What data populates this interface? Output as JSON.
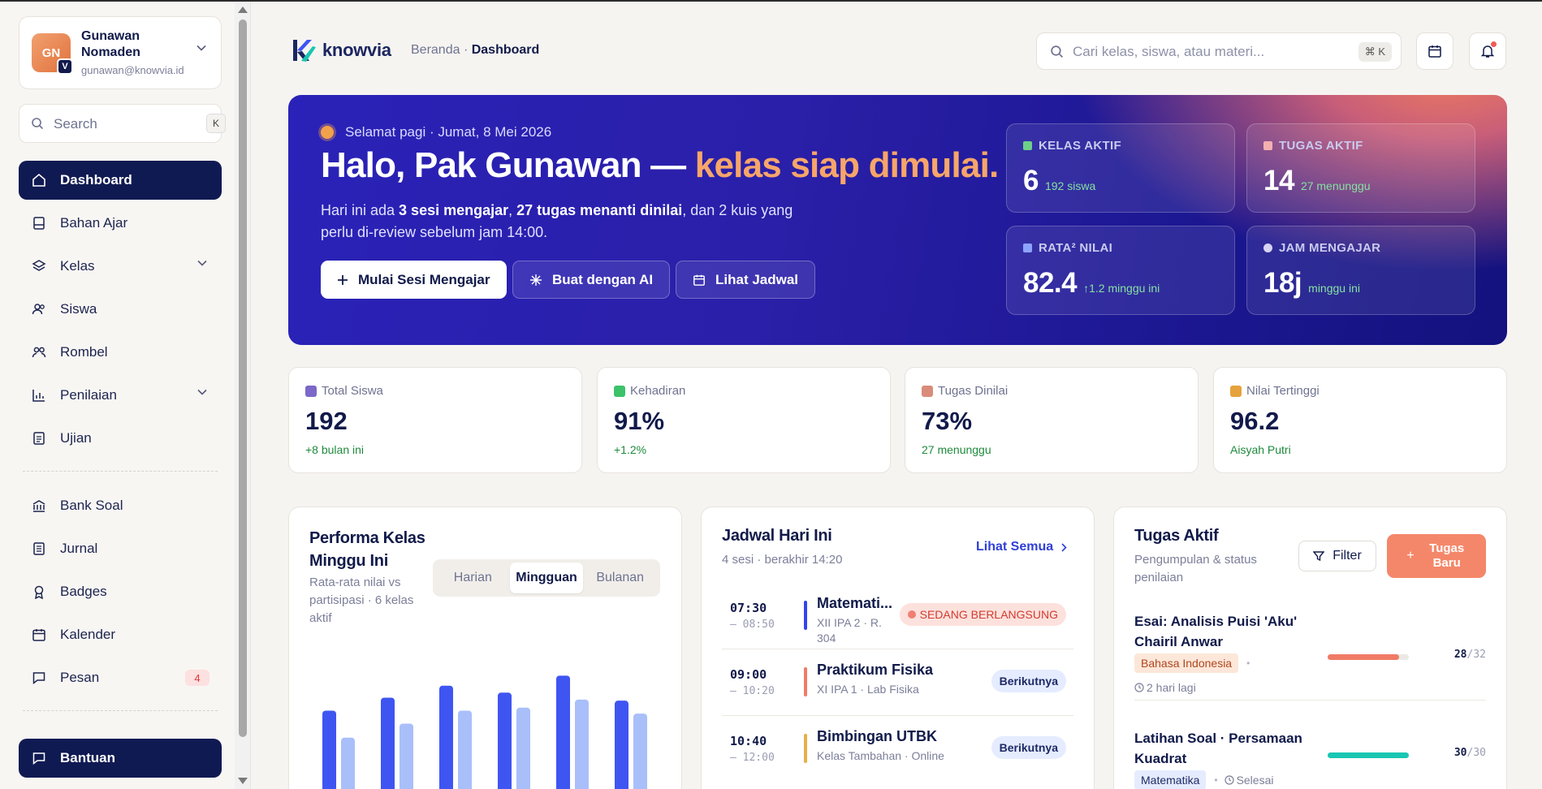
{
  "profile": {
    "initials": "GN",
    "badge": "V",
    "name": "Gunawan Nomaden",
    "email": "gunawan@knowvia.id"
  },
  "sidebar": {
    "search_placeholder": "Search",
    "search_shortcut": "K",
    "items": [
      {
        "label": "Dashboard",
        "icon": "home-icon",
        "active": true
      },
      {
        "label": "Bahan Ajar",
        "icon": "book-icon"
      },
      {
        "label": "Kelas",
        "icon": "layers-icon",
        "expandable": true
      },
      {
        "label": "Siswa",
        "icon": "users-icon"
      },
      {
        "label": "Rombel",
        "icon": "group-icon"
      },
      {
        "label": "Penilaian",
        "icon": "bar-chart-icon",
        "expandable": true
      },
      {
        "label": "Ujian",
        "icon": "document-icon"
      }
    ],
    "items2": [
      {
        "label": "Bank Soal",
        "icon": "bank-icon"
      },
      {
        "label": "Jurnal",
        "icon": "journal-icon"
      },
      {
        "label": "Badges",
        "icon": "award-icon"
      },
      {
        "label": "Kalender",
        "icon": "calendar-icon"
      },
      {
        "label": "Pesan",
        "icon": "message-icon",
        "badge": "4"
      }
    ],
    "help_label": "Bantuan"
  },
  "header": {
    "logo_text": "knowvia",
    "breadcrumb_parent": "Beranda",
    "breadcrumb_sep": " · ",
    "breadcrumb_current": "Dashboard",
    "search_placeholder": "Cari kelas, siswa, atau materi...",
    "search_shortcut": "⌘ K"
  },
  "hero": {
    "greeting": "Selamat pagi · Jumat, 8 Mei 2026",
    "title_main": "Halo, Pak Gunawan — ",
    "title_accent": "kelas siap dimulai.",
    "desc_1": "Hari ini ada ",
    "desc_b1": "3 sesi mengajar",
    "desc_2": ", ",
    "desc_b2": "27 tugas menanti dinilai",
    "desc_3": ", dan 2 kuis yang perlu di-review sebelum jam 14:00.",
    "btn_start": "Mulai Sesi Mengajar",
    "btn_ai": "Buat dengan AI",
    "btn_schedule": "Lihat Jadwal",
    "stats": [
      {
        "label": "KELAS AKTIF",
        "value": "6",
        "sub": "192 siswa",
        "color": "#6ccf8a"
      },
      {
        "label": "TUGAS AKTIF",
        "value": "14",
        "sub": "27 menunggu",
        "color": "#f4b0b0"
      },
      {
        "label": "RATA² NILAI",
        "value": "82.4",
        "sub": "↑1.2 minggu ini",
        "color": "#8da4ff"
      },
      {
        "label": "JAM MENGAJAR",
        "value": "18j",
        "sub": "minggu ini",
        "color": "#d7d3f5"
      }
    ]
  },
  "kpis": [
    {
      "label": "Total Siswa",
      "value": "192",
      "sub": "+8 bulan ini",
      "color": "#7b68c8"
    },
    {
      "label": "Kehadiran",
      "value": "91%",
      "sub": "+1.2%",
      "color": "#3cc26b"
    },
    {
      "label": "Tugas Dinilai",
      "value": "73%",
      "sub": "27 menunggu",
      "color": "#d98c7a"
    },
    {
      "label": "Nilai Tertinggi",
      "value": "96.2",
      "sub": "Aisyah Putri",
      "color": "#e6a23c"
    }
  ],
  "performance": {
    "title_1": "Performa Kelas",
    "title_2": "Minggu Ini",
    "subtitle": "Rata-rata nilai vs partisipasi · 6 kelas aktif",
    "tabs": [
      "Harian",
      "Mingguan",
      "Bulanan"
    ],
    "active_tab": "Mingguan",
    "chart_data": {
      "type": "bar",
      "series": [
        {
          "values": [
            89,
            102,
            114,
            107,
            124,
            99
          ],
          "color": "#3f55f2"
        },
        {
          "values": [
            62,
            76,
            89,
            92,
            100,
            86
          ],
          "color": "#a9bffa"
        }
      ]
    }
  },
  "schedule": {
    "title": "Jadwal Hari Ini",
    "subtitle": "4 sesi · berakhir 14:20",
    "see_all": "Lihat Semua",
    "rows": [
      {
        "start": "07:30",
        "end": "– 08:50",
        "title": "Matemati...",
        "meta": "XII IPA 2 · R. 304",
        "bar": "#3344ee",
        "status": "SEDANG BERLANGSUNG",
        "live": true
      },
      {
        "start": "09:00",
        "end": "– 10:20",
        "title": "Praktikum Fisika",
        "meta": "XI IPA 1 · Lab Fisika",
        "bar": "#f07b66",
        "status": "Berikutnya",
        "live": false
      },
      {
        "start": "10:40",
        "end": "– 12:00",
        "title": "Bimbingan UTBK",
        "meta": "Kelas Tambahan · Online",
        "bar": "#e6b04a",
        "status": "Berikutnya",
        "live": false
      }
    ]
  },
  "tasks": {
    "title": "Tugas Aktif",
    "subtitle": "Pengumpulan & status penilaian",
    "filter_label": "Filter",
    "new_label": "Tugas Baru",
    "items": [
      {
        "title": "Esai: Analisis Puisi 'Aku' Chairil Anwar",
        "tag": "Bahasa Indonesia",
        "sep": "•",
        "meta": "2 hari lagi",
        "done": 28,
        "total": "/32",
        "progress": 0.875,
        "color": "#f07b66"
      },
      {
        "title": "Latihan Soal · Persamaan Kuadrat",
        "tag": "Matematika",
        "sep": "•",
        "meta": "Selesai",
        "done": 30,
        "total": "/30",
        "progress": 1.0,
        "color": "#19c6b2"
      }
    ]
  }
}
